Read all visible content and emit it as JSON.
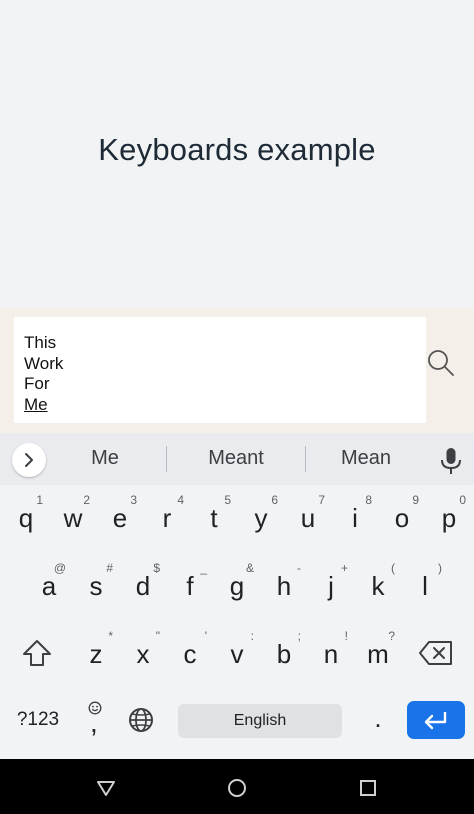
{
  "app": {
    "title": "Keyboards example"
  },
  "input": {
    "lines": [
      "This",
      "Work",
      "For"
    ],
    "composing": "Me"
  },
  "keyboard": {
    "suggestions": [
      "Me",
      "Meant",
      "Mean"
    ],
    "row1": [
      {
        "key": "q",
        "hint": "1"
      },
      {
        "key": "w",
        "hint": "2"
      },
      {
        "key": "e",
        "hint": "3"
      },
      {
        "key": "r",
        "hint": "4"
      },
      {
        "key": "t",
        "hint": "5"
      },
      {
        "key": "y",
        "hint": "6"
      },
      {
        "key": "u",
        "hint": "7"
      },
      {
        "key": "i",
        "hint": "8"
      },
      {
        "key": "o",
        "hint": "9"
      },
      {
        "key": "p",
        "hint": "0"
      }
    ],
    "row2": [
      {
        "key": "a",
        "hint": "@"
      },
      {
        "key": "s",
        "hint": "#"
      },
      {
        "key": "d",
        "hint": "$"
      },
      {
        "key": "f",
        "hint": "_"
      },
      {
        "key": "g",
        "hint": "&"
      },
      {
        "key": "h",
        "hint": "-"
      },
      {
        "key": "j",
        "hint": "+"
      },
      {
        "key": "k",
        "hint": "("
      },
      {
        "key": "l",
        "hint": ")"
      }
    ],
    "row3": [
      {
        "key": "z",
        "hint": "*"
      },
      {
        "key": "x",
        "hint": "\""
      },
      {
        "key": "c",
        "hint": "'"
      },
      {
        "key": "v",
        "hint": ":"
      },
      {
        "key": "b",
        "hint": ";"
      },
      {
        "key": "n",
        "hint": "!"
      },
      {
        "key": "m",
        "hint": "?"
      }
    ],
    "symbols_label": "?123",
    "comma": ",",
    "space_label": "English",
    "period": ".",
    "enter_color": "#1a73e8",
    "icons": {
      "expand": "chevron-right-icon",
      "mic": "mic-icon",
      "shift": "shift-icon",
      "backspace": "backspace-icon",
      "emoji": "emoji-icon",
      "globe": "globe-icon",
      "enter": "enter-icon",
      "search": "search-icon"
    }
  },
  "navbar": {
    "icons": [
      "back-triangle-icon",
      "home-circle-icon",
      "recents-square-icon"
    ]
  }
}
